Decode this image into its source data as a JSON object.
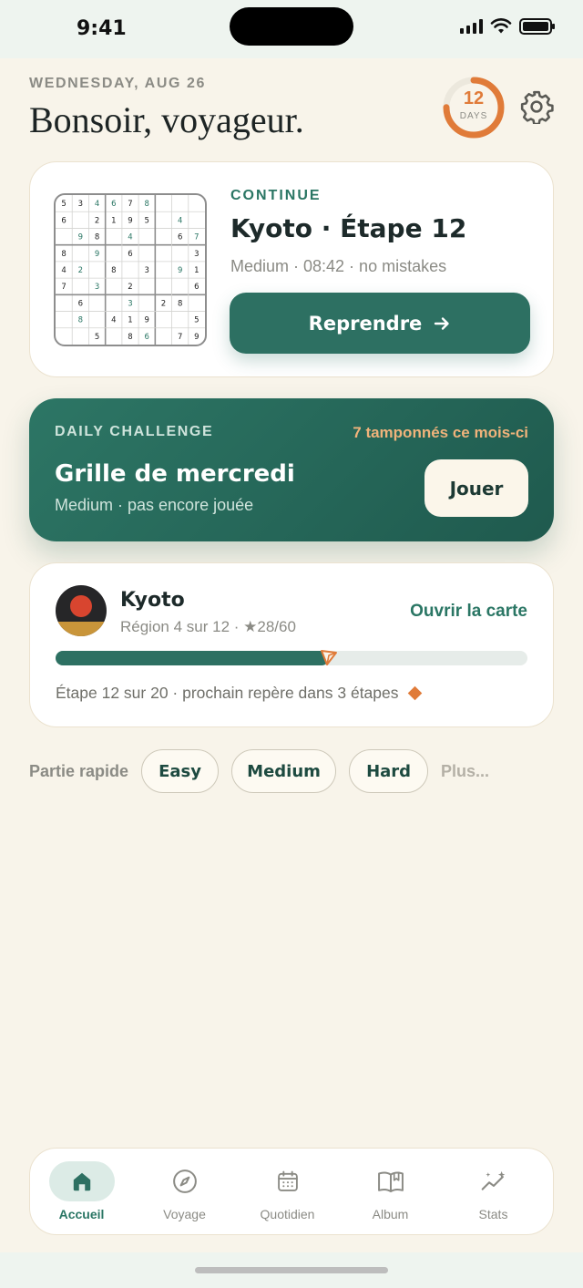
{
  "status_bar": {
    "time": "9:41"
  },
  "header": {
    "date": "WEDNESDAY, AUG 26",
    "greeting": "Bonsoir, voyageur.",
    "streak": {
      "count": "12",
      "unit": "DAYS",
      "progress": 0.75
    }
  },
  "continue_card": {
    "tag": "CONTINUE",
    "title": "Kyoto · Étape 12",
    "meta": "Medium · 08:42 · no mistakes",
    "button_label": "Reprendre",
    "grid": [
      [
        "5",
        "3",
        "4",
        "6",
        "7",
        "8",
        "",
        "",
        ""
      ],
      [
        "6",
        "",
        "2",
        "1",
        "9",
        "5",
        "",
        "4",
        ""
      ],
      [
        "",
        "9",
        "8",
        "",
        "4",
        "",
        "",
        "6",
        "7"
      ],
      [
        "8",
        "",
        "9",
        "",
        "6",
        "",
        "",
        "",
        "3"
      ],
      [
        "4",
        "2",
        "",
        "8",
        "",
        "3",
        "",
        "9",
        "1"
      ],
      [
        "7",
        "",
        "3",
        "",
        "2",
        "",
        "",
        "",
        "6"
      ],
      [
        "",
        "6",
        "",
        "",
        "3",
        "",
        "2",
        "8",
        ""
      ],
      [
        "",
        "8",
        "",
        "4",
        "1",
        "9",
        "",
        "",
        "5"
      ],
      [
        "",
        "",
        "5",
        "",
        "8",
        "6",
        "",
        "7",
        "9"
      ]
    ],
    "grid_user_cells": [
      [
        0,
        2
      ],
      [
        0,
        3
      ],
      [
        0,
        5
      ],
      [
        1,
        7
      ],
      [
        2,
        1
      ],
      [
        2,
        4
      ],
      [
        2,
        8
      ],
      [
        3,
        2
      ],
      [
        4,
        1
      ],
      [
        4,
        7
      ],
      [
        5,
        2
      ],
      [
        6,
        4
      ],
      [
        7,
        1
      ],
      [
        8,
        5
      ]
    ]
  },
  "daily_challenge": {
    "tag": "DAILY CHALLENGE",
    "stamps": "7 tamponnés ce mois-ci",
    "title": "Grille de mercredi",
    "subtitle": "Medium · pas encore jouée",
    "button_label": "Jouer"
  },
  "region_card": {
    "name": "Kyoto",
    "meta": "Région 4 sur 12 · ★28/60",
    "link_label": "Ouvrir la carte",
    "progress": 0.58,
    "footer": "Étape 12 sur 20 · prochain repère dans 3 étapes"
  },
  "quick_play": {
    "label": "Partie rapide",
    "chips": [
      "Easy",
      "Medium",
      "Hard"
    ],
    "more_label": "Plus..."
  },
  "tabs": [
    {
      "label": "Accueil",
      "icon": "home-icon",
      "active": true
    },
    {
      "label": "Voyage",
      "icon": "compass-icon",
      "active": false
    },
    {
      "label": "Quotidien",
      "icon": "calendar-icon",
      "active": false
    },
    {
      "label": "Album",
      "icon": "book-icon",
      "active": false
    },
    {
      "label": "Stats",
      "icon": "sparkle-chart-icon",
      "active": false
    }
  ],
  "colors": {
    "accent": "#2d7062",
    "accent_text": "#2a7664",
    "streak": "#e07b39",
    "background": "#f8f4ea",
    "stamp_text": "#f0b37b"
  }
}
